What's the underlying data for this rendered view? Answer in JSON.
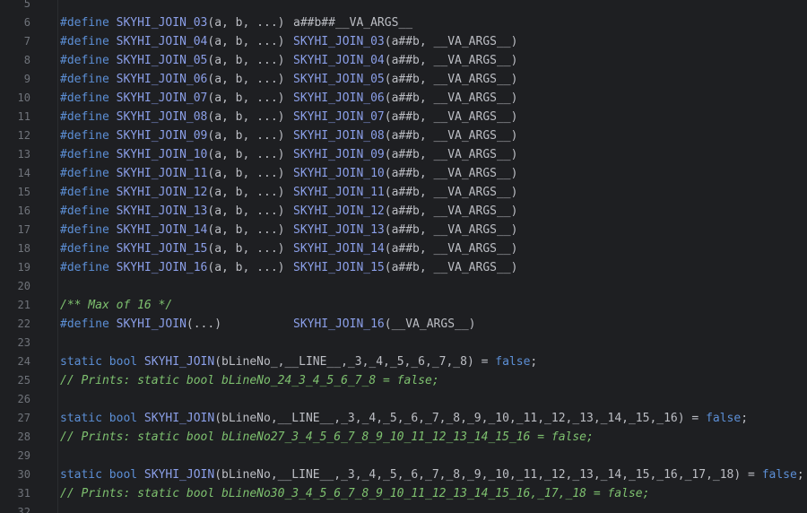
{
  "editor": {
    "lines": [
      {
        "num": "5"
      },
      {
        "num": "6",
        "segs": [
          [
            "kw",
            "#define "
          ],
          [
            "mac",
            "SKYHI_JOIN_03"
          ],
          [
            "txt",
            "(a, b, ...)"
          ]
        ],
        "col2": [
          [
            "txt",
            "a##b##__VA_ARGS__"
          ]
        ]
      },
      {
        "num": "7",
        "segs": [
          [
            "kw",
            "#define "
          ],
          [
            "mac",
            "SKYHI_JOIN_04"
          ],
          [
            "txt",
            "(a, b, ...)"
          ]
        ],
        "col2": [
          [
            "mac",
            "SKYHI_JOIN_03"
          ],
          [
            "txt",
            "(a##b, __VA_ARGS__)"
          ]
        ]
      },
      {
        "num": "8",
        "segs": [
          [
            "kw",
            "#define "
          ],
          [
            "mac",
            "SKYHI_JOIN_05"
          ],
          [
            "txt",
            "(a, b, ...)"
          ]
        ],
        "col2": [
          [
            "mac",
            "SKYHI_JOIN_04"
          ],
          [
            "txt",
            "(a##b, __VA_ARGS__)"
          ]
        ]
      },
      {
        "num": "9",
        "segs": [
          [
            "kw",
            "#define "
          ],
          [
            "mac",
            "SKYHI_JOIN_06"
          ],
          [
            "txt",
            "(a, b, ...)"
          ]
        ],
        "col2": [
          [
            "mac",
            "SKYHI_JOIN_05"
          ],
          [
            "txt",
            "(a##b, __VA_ARGS__)"
          ]
        ]
      },
      {
        "num": "10",
        "segs": [
          [
            "kw",
            "#define "
          ],
          [
            "mac",
            "SKYHI_JOIN_07"
          ],
          [
            "txt",
            "(a, b, ...)"
          ]
        ],
        "col2": [
          [
            "mac",
            "SKYHI_JOIN_06"
          ],
          [
            "txt",
            "(a##b, __VA_ARGS__)"
          ]
        ]
      },
      {
        "num": "11",
        "segs": [
          [
            "kw",
            "#define "
          ],
          [
            "mac",
            "SKYHI_JOIN_08"
          ],
          [
            "txt",
            "(a, b, ...)"
          ]
        ],
        "col2": [
          [
            "mac",
            "SKYHI_JOIN_07"
          ],
          [
            "txt",
            "(a##b, __VA_ARGS__)"
          ]
        ]
      },
      {
        "num": "12",
        "segs": [
          [
            "kw",
            "#define "
          ],
          [
            "mac",
            "SKYHI_JOIN_09"
          ],
          [
            "txt",
            "(a, b, ...)"
          ]
        ],
        "col2": [
          [
            "mac",
            "SKYHI_JOIN_08"
          ],
          [
            "txt",
            "(a##b, __VA_ARGS__)"
          ]
        ]
      },
      {
        "num": "13",
        "segs": [
          [
            "kw",
            "#define "
          ],
          [
            "mac",
            "SKYHI_JOIN_10"
          ],
          [
            "txt",
            "(a, b, ...)"
          ]
        ],
        "col2": [
          [
            "mac",
            "SKYHI_JOIN_09"
          ],
          [
            "txt",
            "(a##b, __VA_ARGS__)"
          ]
        ]
      },
      {
        "num": "14",
        "segs": [
          [
            "kw",
            "#define "
          ],
          [
            "mac",
            "SKYHI_JOIN_11"
          ],
          [
            "txt",
            "(a, b, ...)"
          ]
        ],
        "col2": [
          [
            "mac",
            "SKYHI_JOIN_10"
          ],
          [
            "txt",
            "(a##b, __VA_ARGS__)"
          ]
        ]
      },
      {
        "num": "15",
        "segs": [
          [
            "kw",
            "#define "
          ],
          [
            "mac",
            "SKYHI_JOIN_12"
          ],
          [
            "txt",
            "(a, b, ...)"
          ]
        ],
        "col2": [
          [
            "mac",
            "SKYHI_JOIN_11"
          ],
          [
            "txt",
            "(a##b, __VA_ARGS__)"
          ]
        ]
      },
      {
        "num": "16",
        "segs": [
          [
            "kw",
            "#define "
          ],
          [
            "mac",
            "SKYHI_JOIN_13"
          ],
          [
            "txt",
            "(a, b, ...)"
          ]
        ],
        "col2": [
          [
            "mac",
            "SKYHI_JOIN_12"
          ],
          [
            "txt",
            "(a##b, __VA_ARGS__)"
          ]
        ]
      },
      {
        "num": "17",
        "segs": [
          [
            "kw",
            "#define "
          ],
          [
            "mac",
            "SKYHI_JOIN_14"
          ],
          [
            "txt",
            "(a, b, ...)"
          ]
        ],
        "col2": [
          [
            "mac",
            "SKYHI_JOIN_13"
          ],
          [
            "txt",
            "(a##b, __VA_ARGS__)"
          ]
        ]
      },
      {
        "num": "18",
        "segs": [
          [
            "kw",
            "#define "
          ],
          [
            "mac",
            "SKYHI_JOIN_15"
          ],
          [
            "txt",
            "(a, b, ...)"
          ]
        ],
        "col2": [
          [
            "mac",
            "SKYHI_JOIN_14"
          ],
          [
            "txt",
            "(a##b, __VA_ARGS__)"
          ]
        ]
      },
      {
        "num": "19",
        "segs": [
          [
            "kw",
            "#define "
          ],
          [
            "mac",
            "SKYHI_JOIN_16"
          ],
          [
            "txt",
            "(a, b, ...)"
          ]
        ],
        "col2": [
          [
            "mac",
            "SKYHI_JOIN_15"
          ],
          [
            "txt",
            "(a##b, __VA_ARGS__)"
          ]
        ]
      },
      {
        "num": "20"
      },
      {
        "num": "21",
        "segs": [
          [
            "cmt",
            "/** Max of 16 */"
          ]
        ]
      },
      {
        "num": "22",
        "segs": [
          [
            "kw",
            "#define "
          ],
          [
            "mac",
            "SKYHI_JOIN"
          ],
          [
            "txt",
            "(...)"
          ]
        ],
        "col2": [
          [
            "mac",
            "SKYHI_JOIN_16"
          ],
          [
            "txt",
            "(__VA_ARGS__)"
          ]
        ]
      },
      {
        "num": "23"
      },
      {
        "num": "24",
        "segs": [
          [
            "kw",
            "static bool "
          ],
          [
            "mac",
            "SKYHI_JOIN"
          ],
          [
            "txt",
            "(bLineNo_,__LINE__,_3,_4,_5,_6,_7,_8) = "
          ],
          [
            "kw",
            "false"
          ],
          [
            "txt",
            ";"
          ]
        ]
      },
      {
        "num": "25",
        "segs": [
          [
            "cmt",
            "// Prints: static bool bLineNo_24_3_4_5_6_7_8 = false;"
          ]
        ]
      },
      {
        "num": "26"
      },
      {
        "num": "27",
        "segs": [
          [
            "kw",
            "static bool "
          ],
          [
            "mac",
            "SKYHI_JOIN"
          ],
          [
            "txt",
            "(bLineNo,__LINE__,_3,_4,_5,_6,_7,_8,_9,_10,_11,_12,_13,_14,_15,_16) = "
          ],
          [
            "kw",
            "false"
          ],
          [
            "txt",
            ";"
          ]
        ]
      },
      {
        "num": "28",
        "segs": [
          [
            "cmt",
            "// Prints: static bool bLineNo27_3_4_5_6_7_8_9_10_11_12_13_14_15_16 = false;"
          ]
        ]
      },
      {
        "num": "29"
      },
      {
        "num": "30",
        "segs": [
          [
            "kw",
            "static bool "
          ],
          [
            "mac",
            "SKYHI_JOIN"
          ],
          [
            "txt",
            "(bLineNo,__LINE__,_3,_4,_5,_6,_7,_8,_9,_10,_11,_12,_13,_14,_15,_16,_17,_18) = "
          ],
          [
            "kw",
            "false"
          ],
          [
            "txt",
            ";"
          ]
        ]
      },
      {
        "num": "31",
        "segs": [
          [
            "cmt",
            "// Prints: static bool bLineNo30_3_4_5_6_7_8_9_10_11_12_13_14_15_16,_17,_18 = false;"
          ]
        ]
      },
      {
        "num": "32"
      }
    ]
  }
}
